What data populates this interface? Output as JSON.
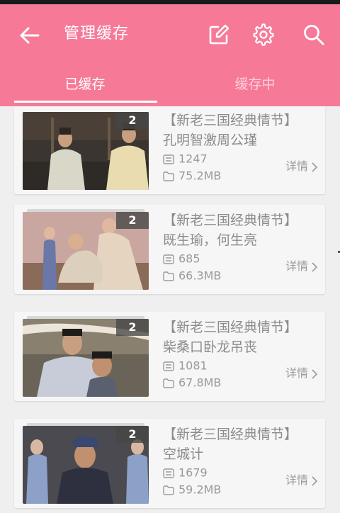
{
  "header": {
    "title": "管理缓存",
    "back_icon": "arrow-left-icon",
    "edit_icon": "edit-icon",
    "settings_icon": "gear-icon",
    "search_icon": "search-icon",
    "bg_color": "#f67a98"
  },
  "tabs": [
    {
      "label": "已缓存",
      "active": true
    },
    {
      "label": "缓存中",
      "active": false
    }
  ],
  "items": [
    {
      "count": "2",
      "line1": "【新老三国经典情节】",
      "line2": "孔明智激周公瑾",
      "views": "1247",
      "size": "75.2MB",
      "detail": "详情"
    },
    {
      "count": "2",
      "line1": "【新老三国经典情节】",
      "line2": "既生瑜，何生亮",
      "views": "685",
      "size": "66.3MB",
      "detail": "详情"
    },
    {
      "count": "2",
      "line1": "【新老三国经典情节】",
      "line2": "柴桑口卧龙吊丧",
      "views": "1081",
      "size": "67.8MB",
      "detail": "详情"
    },
    {
      "count": "2",
      "line1": "【新老三国经典情节】",
      "line2": "空城计",
      "views": "1679",
      "size": "59.2MB",
      "detail": "详情"
    }
  ]
}
